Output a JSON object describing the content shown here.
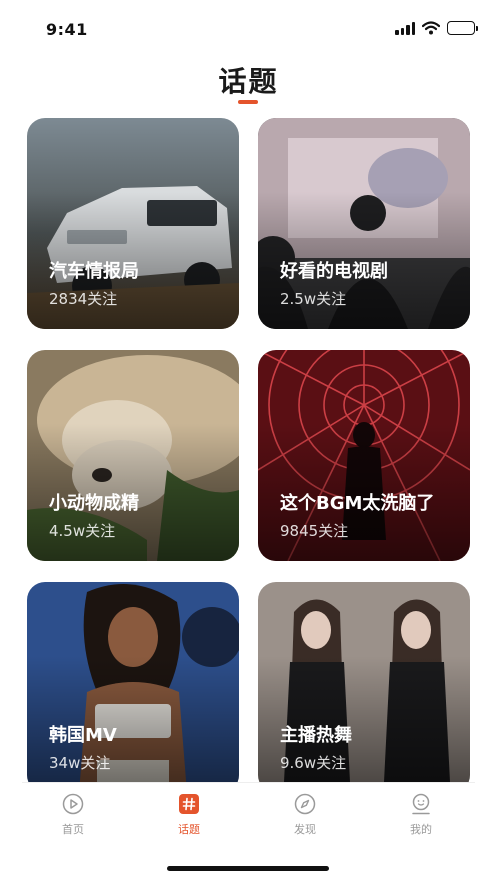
{
  "status_bar": {
    "time": "9:41"
  },
  "page": {
    "title": "话题"
  },
  "topics": [
    {
      "title": "汽车情报局",
      "followers": "2834关注",
      "image": "suv-car-photo"
    },
    {
      "title": "好看的电视剧",
      "followers": "2.5w关注",
      "image": "audience-screen-photo"
    },
    {
      "title": "小动物成精",
      "followers": "4.5w关注",
      "image": "cat-and-dog-photo"
    },
    {
      "title": "这个BGM太洗脑了",
      "followers": "9845关注",
      "image": "neon-dancer-photo"
    },
    {
      "title": "韩国MV",
      "followers": "34w关注",
      "image": "singer-portrait-photo"
    },
    {
      "title": "主播热舞",
      "followers": "9.6w关注",
      "image": "dancers-photo"
    }
  ],
  "tabbar": {
    "items": [
      {
        "label": "首页",
        "icon": "play-circle-icon",
        "active": false
      },
      {
        "label": "话题",
        "icon": "hashtag-icon",
        "active": true
      },
      {
        "label": "发现",
        "icon": "compass-icon",
        "active": false
      },
      {
        "label": "我的",
        "icon": "user-profile-icon",
        "active": false
      }
    ]
  },
  "colors": {
    "accent": "#e4542c",
    "inactive": "#9a9a9a"
  }
}
